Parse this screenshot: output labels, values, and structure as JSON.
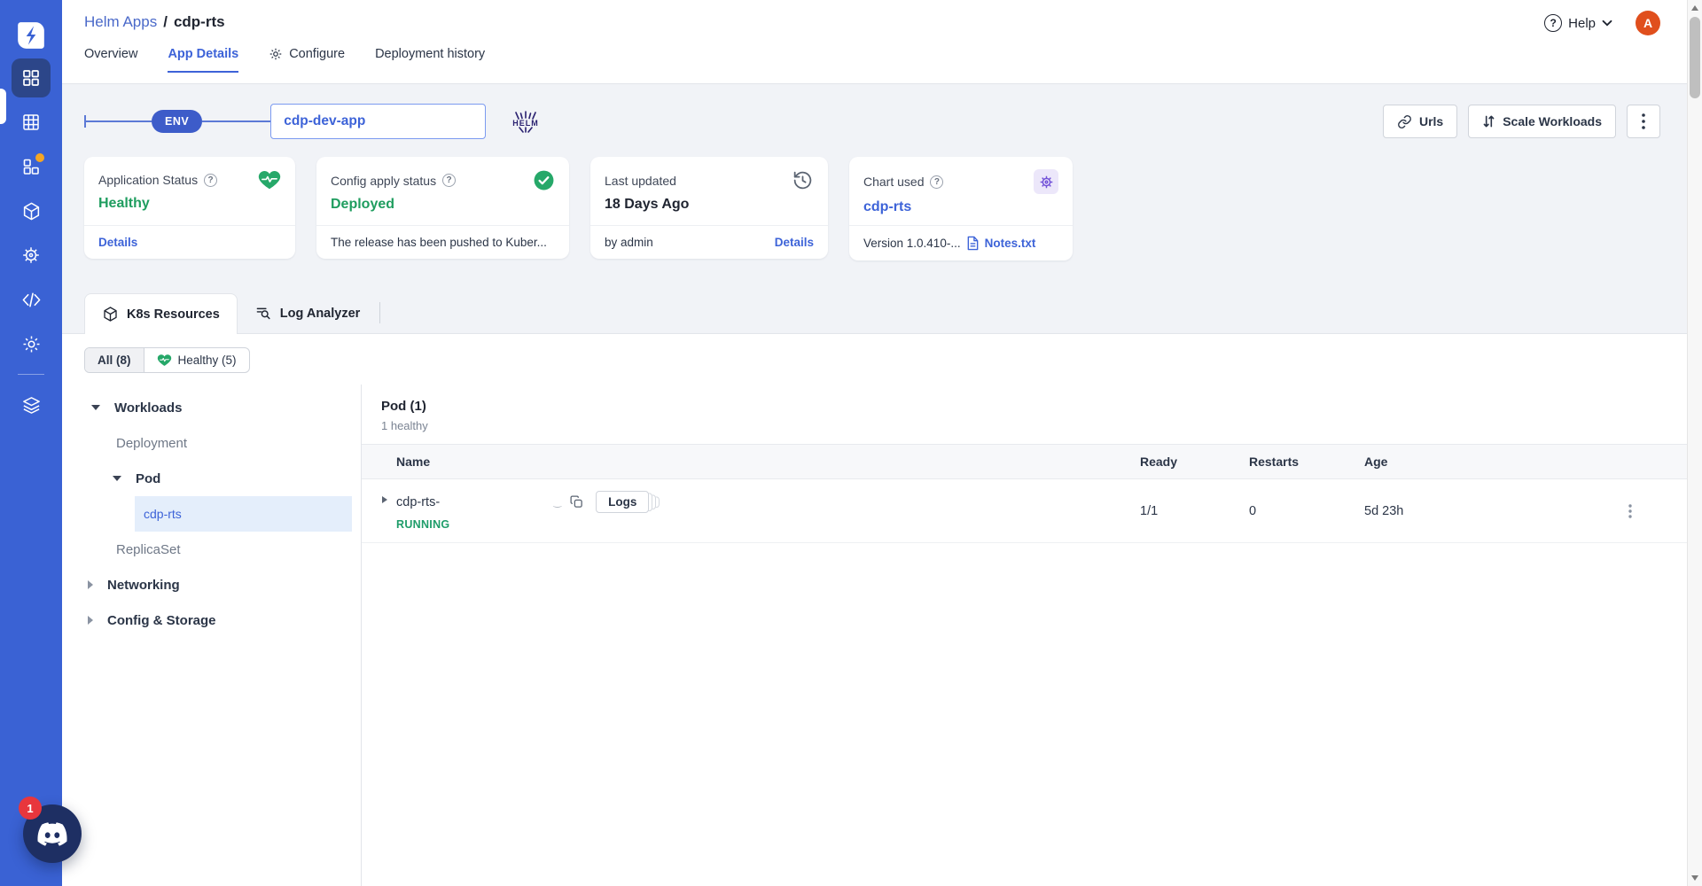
{
  "colors": {
    "accent": "#3d63d8",
    "sidebar_blue": "#3a62d4",
    "success_green": "#1f9d5f",
    "helm_purple": "#7150d8",
    "avatar_orange": "#e04f1d"
  },
  "sidebar": {
    "logo_icon": "devtron-logo",
    "items": [
      {
        "icon": "apps-grid-icon",
        "active": true
      },
      {
        "icon": "app-group-grid-icon",
        "active": false
      },
      {
        "icon": "chart-store-icon",
        "active": false,
        "notification_dot": true
      },
      {
        "icon": "resource-cube-icon",
        "active": false
      },
      {
        "icon": "helm-wheel-icon",
        "active": false
      },
      {
        "icon": "code-icon",
        "active": false
      },
      {
        "icon": "gear-icon",
        "active": false
      },
      {
        "icon": "stack-layers-icon",
        "active": false
      }
    ],
    "chat_badge_count": "1"
  },
  "header": {
    "breadcrumb": {
      "parent": "Helm Apps",
      "separator": "/",
      "current": "cdp-rts"
    },
    "tabs": [
      {
        "label": "Overview",
        "active": false
      },
      {
        "label": "App Details",
        "active": true
      },
      {
        "label": "Configure",
        "active": false,
        "icon": "gear-icon"
      },
      {
        "label": "Deployment history",
        "active": false
      }
    ],
    "help_label": "Help",
    "help_glyph": "?",
    "avatar_initial": "A"
  },
  "env_bar": {
    "env_badge": "ENV",
    "app_name": "cdp-dev-app",
    "helm_logo_text": "HELM",
    "urls_button": "Urls",
    "scale_workloads_button": "Scale Workloads"
  },
  "status_cards": [
    {
      "title": "Application Status",
      "info_glyph": "?",
      "icon": "heart-pulse-icon",
      "value": "Healthy",
      "footer_link": "Details"
    },
    {
      "title": "Config apply status",
      "info_glyph": "?",
      "icon": "check-circle-icon",
      "value": "Deployed",
      "footer_text": "The release has been pushed to Kuber..."
    },
    {
      "title": "Last updated",
      "icon": "history-icon",
      "value": "18 Days Ago",
      "footer_text": "by admin",
      "footer_link": "Details"
    },
    {
      "title": "Chart used",
      "info_glyph": "?",
      "icon": "helm-wheel-icon",
      "value": "cdp-rts",
      "footer_text": "Version 1.0.410-...",
      "footer_link": "Notes.txt"
    }
  ],
  "resource_tabs": [
    {
      "label": "K8s Resources",
      "icon": "cube-icon",
      "active": true
    },
    {
      "label": "Log Analyzer",
      "icon": "log-search-icon",
      "active": false
    }
  ],
  "filters": [
    {
      "label": "All (8)",
      "active": true
    },
    {
      "label": "Healthy (5)",
      "icon": "heart-icon",
      "active": false
    }
  ],
  "resource_tree": {
    "items": [
      {
        "label": "Workloads",
        "depth": 0,
        "state": "expanded"
      },
      {
        "label": "Deployment",
        "depth": 1,
        "state": "none"
      },
      {
        "label": "Pod",
        "depth": 1,
        "state": "expanded"
      },
      {
        "label": "cdp-rts",
        "depth": 2,
        "state": "selected"
      },
      {
        "label": "ReplicaSet",
        "depth": 1,
        "state": "none"
      },
      {
        "label": "Networking",
        "depth": 0,
        "state": "collapsed"
      },
      {
        "label": "Config & Storage",
        "depth": 0,
        "state": "collapsed"
      }
    ]
  },
  "pod_table": {
    "title": "Pod (1)",
    "subtitle": "1 healthy",
    "columns": [
      "Name",
      "Ready",
      "Restarts",
      "Age"
    ],
    "rows": [
      {
        "name": "cdp-rts-",
        "blur_mark": "‿",
        "logs_button": "Logs",
        "status": "RUNNING",
        "ready": "1/1",
        "restarts": "0",
        "age": "5d 23h"
      }
    ]
  }
}
